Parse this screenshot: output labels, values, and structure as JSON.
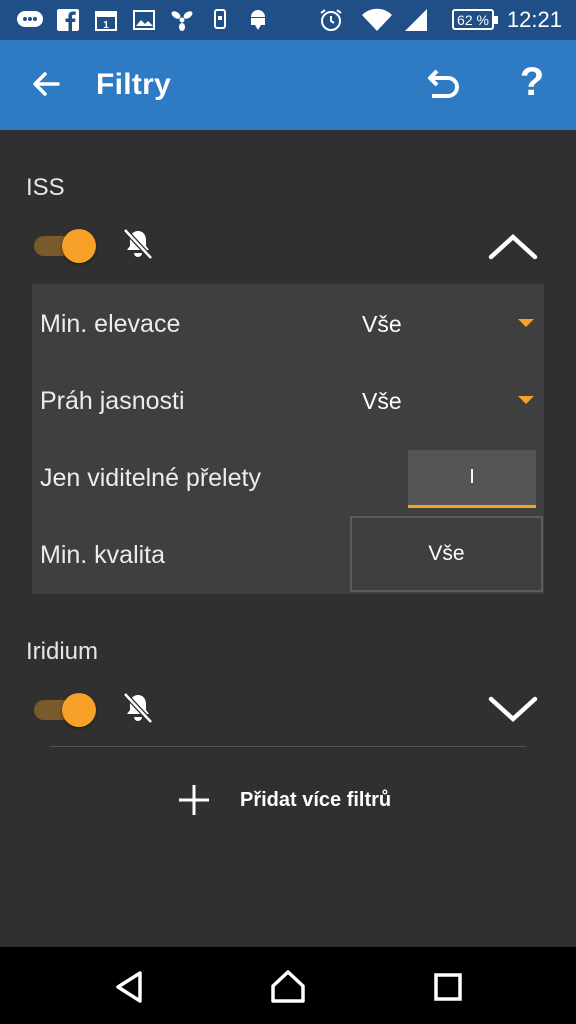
{
  "status_bar": {
    "time": "12:21",
    "battery": "62 %",
    "icons": [
      "messaging-icon",
      "facebook-icon",
      "calendar-icon",
      "gallery-icon",
      "fan-icon",
      "phone-sync-icon",
      "android-download-icon",
      "alarm-icon",
      "wifi-icon",
      "signal-icon"
    ]
  },
  "appbar": {
    "title": "Filtry",
    "back_icon": "arrow-back-icon",
    "undo_icon": "undo-icon",
    "help_label": "?"
  },
  "sections": [
    {
      "title": "ISS",
      "enabled": true,
      "notifications": "off",
      "expanded": true,
      "rows": [
        {
          "label": "Min. elevace",
          "value": "Vše"
        },
        {
          "label": "Práh jasnosti",
          "value": "Vše"
        },
        {
          "label": "Jen viditelné přelety",
          "value": "I"
        },
        {
          "label": "Min. kvalita",
          "value": "Vše"
        }
      ]
    },
    {
      "title": "Iridium",
      "enabled": true,
      "notifications": "off",
      "expanded": false
    }
  ],
  "add_button": {
    "label": "Přidat více filtrů"
  },
  "colors": {
    "accent": "#f7a02a",
    "appbar": "#2e7bc4",
    "statusbar": "#1f4f86",
    "background": "#303030",
    "panel": "#3f3f3f"
  }
}
